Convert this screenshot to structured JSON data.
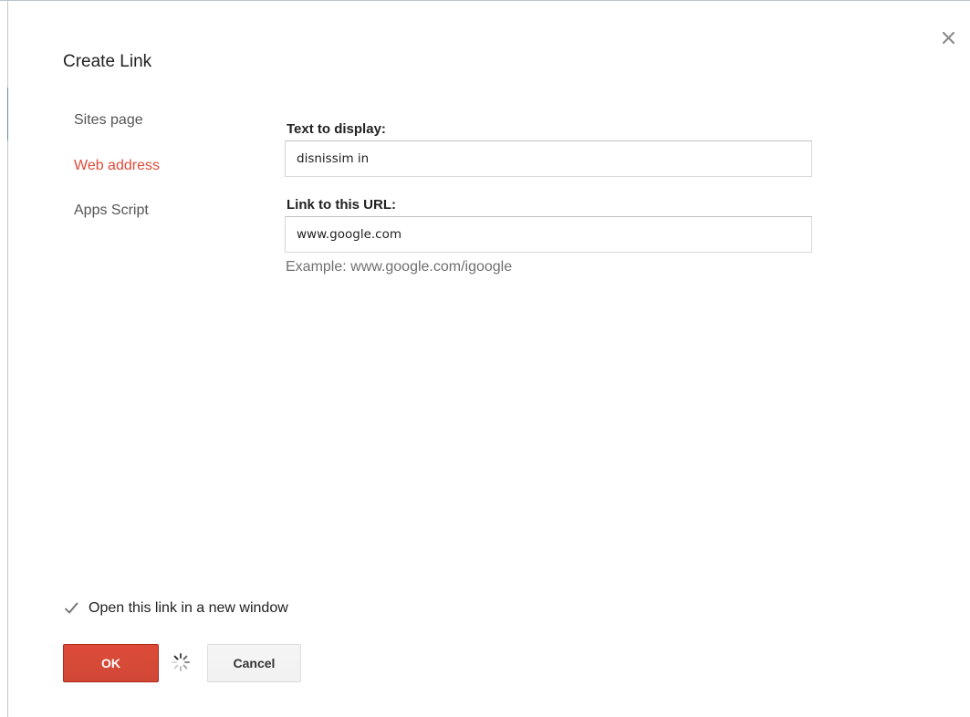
{
  "dialog": {
    "title": "Create Link",
    "close_icon": "close-icon"
  },
  "nav": {
    "items": [
      {
        "label": "Sites page",
        "active": false
      },
      {
        "label": "Web address",
        "active": true
      },
      {
        "label": "Apps Script",
        "active": false
      }
    ],
    "active_color": "#dd4b39"
  },
  "form": {
    "text_label": "Text to display:",
    "text_value": "disnissim in",
    "url_label": "Link to this URL:",
    "url_value": "www.google.com",
    "example": "Example: www.google.com/igoogle"
  },
  "options": {
    "new_window_label": "Open this link in a new window",
    "new_window_checked": true
  },
  "buttons": {
    "ok_label": "OK",
    "ok_color": "#dd4b39",
    "cancel_label": "Cancel"
  },
  "status": {
    "loading_icon": "spinner-icon"
  }
}
